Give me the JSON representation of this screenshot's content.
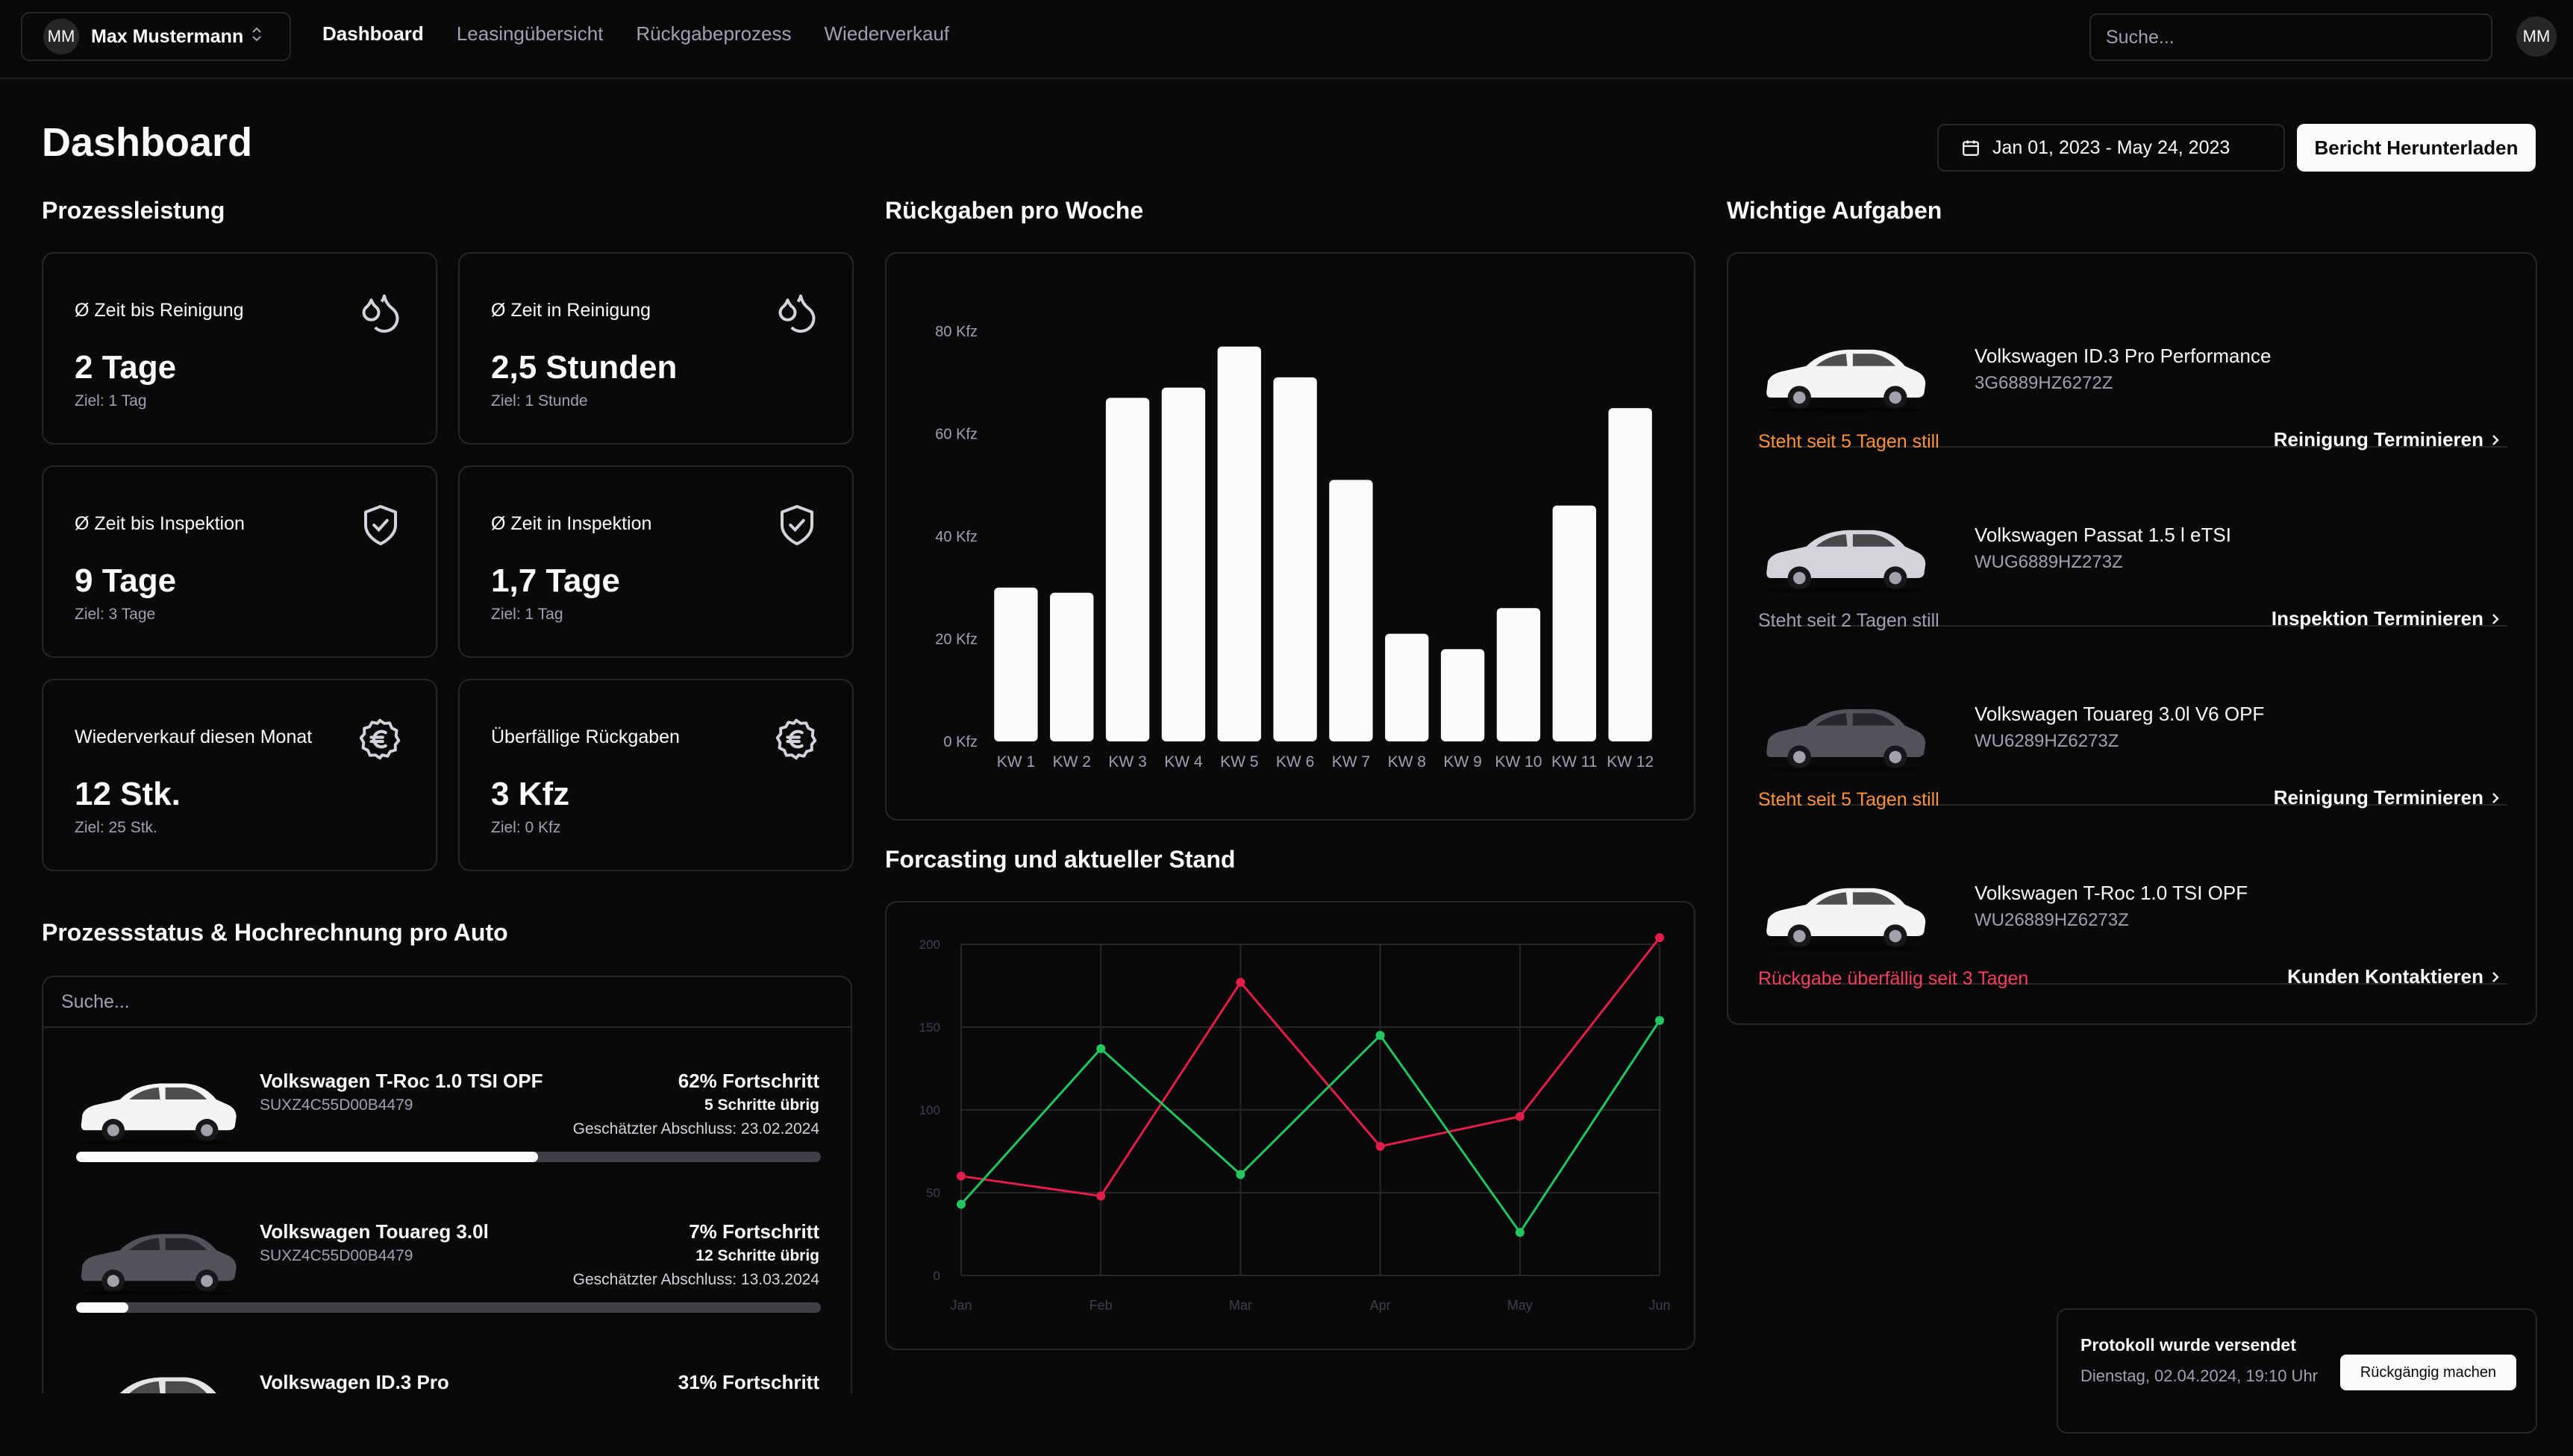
{
  "nav": {
    "user_initials": "MM",
    "user_name": "Max Mustermann",
    "links": [
      "Dashboard",
      "Leasingübersicht",
      "Rückgabeprozess",
      "Wiederverkauf"
    ],
    "search_placeholder": "Suche...",
    "avatar_initials": "MM"
  },
  "header": {
    "title": "Dashboard",
    "date_range": "Jan 01, 2023 - May 24, 2023",
    "download_label": "Bericht Herunterladen"
  },
  "kpi": {
    "section_title": "Prozessleistung",
    "cards": [
      {
        "label": "Ø Zeit bis Reinigung",
        "value": "2 Tage",
        "goal": "Ziel: 1 Tag",
        "icon": "droplets-icon"
      },
      {
        "label": "Ø Zeit in Reinigung",
        "value": "2,5 Stunden",
        "goal": "Ziel: 1 Stunde",
        "icon": "droplets-icon"
      },
      {
        "label": "Ø Zeit bis Inspektion",
        "value": "9 Tage",
        "goal": "Ziel: 3 Tage",
        "icon": "shield-check-icon"
      },
      {
        "label": "Ø Zeit in Inspektion",
        "value": "1,7 Tage",
        "goal": "Ziel: 1 Tag",
        "icon": "shield-check-icon"
      },
      {
        "label": "Wiederverkauf diesen Monat",
        "value": "12 Stk.",
        "goal": "Ziel: 25 Stk.",
        "icon": "euro-icon"
      },
      {
        "label": "Überfällige Rückgaben",
        "value": "3 Kfz",
        "goal": "Ziel: 0 Kfz",
        "icon": "euro-icon"
      }
    ]
  },
  "progress": {
    "section_title": "Prozessstatus & Hochrechnung pro Auto",
    "search_placeholder": "Suche...",
    "items": [
      {
        "name": "Volkswagen T-Roc 1.0 TSI OPF",
        "vin": "SUXZ4C55D00B4479",
        "percent_label": "62% Fortschritt",
        "steps_label": "5 Schritte übrig",
        "eta_label": "Geschätzter Abschluss: 23.02.2024",
        "progress": 0.62,
        "car_color": "#f4f4f5"
      },
      {
        "name": "Volkswagen Touareg 3.0l",
        "vin": "SUXZ4C55D00B4479",
        "percent_label": "7% Fortschritt",
        "steps_label": "12 Schritte übrig",
        "eta_label": "Geschätzter Abschluss: 13.03.2024",
        "progress": 0.07,
        "car_color": "#52525b"
      },
      {
        "name": "Volkswagen ID.3 Pro",
        "vin": "",
        "percent_label": "31% Fortschritt",
        "steps_label": "",
        "eta_label": "",
        "progress": 0.31,
        "car_color": "#e4e4e7"
      }
    ]
  },
  "bar_chart": {
    "section_title": "Rückgaben pro Woche",
    "chart_data": {
      "type": "bar",
      "categories": [
        "KW 1",
        "KW 2",
        "KW 3",
        "KW 4",
        "KW 5",
        "KW 6",
        "KW 7",
        "KW 8",
        "KW 9",
        "KW 10",
        "KW 11",
        "KW 12"
      ],
      "values": [
        30,
        29,
        67,
        69,
        77,
        71,
        51,
        21,
        18,
        26,
        46,
        65
      ],
      "ylim": [
        0,
        80
      ],
      "yticks": [
        0,
        20,
        40,
        60,
        80
      ],
      "ytick_labels": [
        "0 Kfz",
        "20 Kfz",
        "40 Kfz",
        "60 Kfz",
        "80 Kfz"
      ],
      "bar_color": "#fafafa"
    }
  },
  "line_chart": {
    "section_title": "Forcasting und aktueller Stand",
    "chart_data": {
      "type": "line",
      "categories": [
        "Jan",
        "Feb",
        "Mar",
        "Apr",
        "May",
        "Jun"
      ],
      "series": [
        {
          "values": [
            60,
            48,
            177,
            78,
            96,
            204
          ],
          "color": "#e11d48"
        },
        {
          "values": [
            43,
            137,
            61,
            145,
            26,
            154
          ],
          "color": "#22c55e"
        }
      ],
      "ylim": [
        0,
        200
      ],
      "yticks": [
        0,
        50,
        100,
        150,
        200
      ],
      "grid": true
    }
  },
  "tasks": {
    "section_title": "Wichtige Aufgaben",
    "items": [
      {
        "name": "Volkswagen ID.3 Pro Performance",
        "vin": "3G6889HZ6272Z",
        "status": "Steht seit 5 Tagen still",
        "status_color": "#fb923c",
        "action": "Reinigung Terminieren",
        "car_color": "#f4f4f5"
      },
      {
        "name": "Volkswagen Passat 1.5 l eTSI",
        "vin": "WUG6889HZ273Z",
        "status": "Steht seit 2 Tagen still",
        "status_color": "#a1a1aa",
        "action": "Inspektion Terminieren",
        "car_color": "#d4d4d8"
      },
      {
        "name": "Volkswagen Touareg 3.0l V6 OPF",
        "vin": "WU6289HZ6273Z",
        "status": "Steht seit 5 Tagen still",
        "status_color": "#fb923c",
        "action": "Reinigung Terminieren",
        "car_color": "#52525b"
      },
      {
        "name": "Volkswagen T-Roc 1.0 TSI OPF",
        "vin": "WU26889HZ6273Z",
        "status": "Rückgabe überfällig seit 3 Tagen",
        "status_color": "#f43f5e",
        "action": "Kunden Kontaktieren",
        "car_color": "#f4f4f5"
      }
    ]
  },
  "toast": {
    "title": "Protokoll wurde versendet",
    "description": "Dienstag, 02.04.2024, 19:10 Uhr",
    "action": "Rückgängig machen"
  }
}
